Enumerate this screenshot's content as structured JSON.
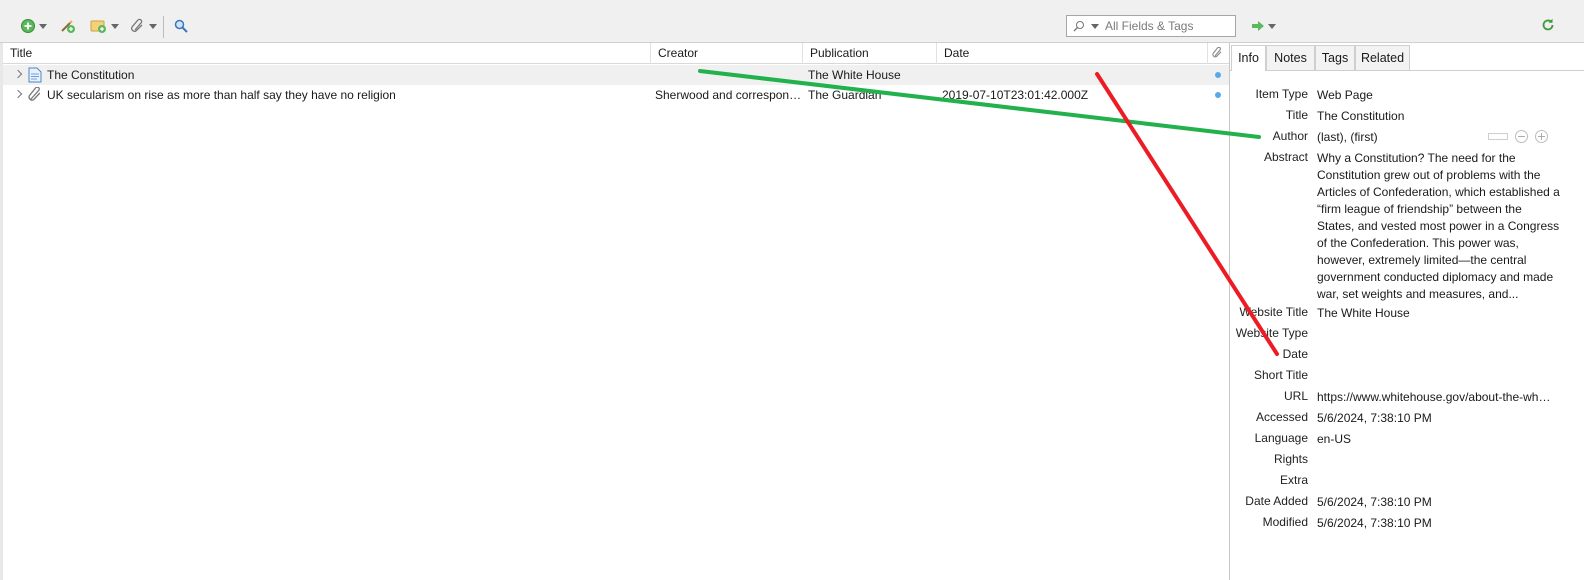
{
  "toolbar": {
    "search_placeholder": "All Fields & Tags",
    "icons": [
      "new-item-icon",
      "new-note-icon",
      "add-attachment-folder-icon",
      "attachment-icon",
      "advanced-search-icon",
      "locate-icon",
      "sync-icon"
    ]
  },
  "items_table": {
    "columns": [
      "Title",
      "Creator",
      "Publication",
      "Date"
    ],
    "rows": [
      {
        "title": "The Constitution",
        "creator": "",
        "publication": "The White House",
        "date": "",
        "type": "web-page"
      },
      {
        "title": "UK secularism on rise as more than half say they have no religion",
        "creator": "Sherwood and correspon…",
        "publication": "The Guardian",
        "date": "2019-07-10T23:01:42.000Z",
        "type": "newspaper-article"
      }
    ]
  },
  "item_pane": {
    "tabs": [
      "Info",
      "Notes",
      "Tags",
      "Related"
    ],
    "active_tab": "Info",
    "fields": [
      {
        "label": "Item Type",
        "value": "Web Page"
      },
      {
        "label": "Title",
        "value": "The Constitution"
      },
      {
        "label": "Author",
        "value": "(last), (first)"
      },
      {
        "label": "Abstract",
        "value": "Why a Constitution? The need for the Constitution grew out of problems with the Articles of Confederation, which established a “firm league of friendship” between the States, and vested most power in a Congress of the Confederation. This power was, however, extremely limited—the central government conducted diplomacy and made war, set weights and measures, and..."
      },
      {
        "label": "Website Title",
        "value": "The White House"
      },
      {
        "label": "Website Type",
        "value": ""
      },
      {
        "label": "Date",
        "value": ""
      },
      {
        "label": "Short Title",
        "value": ""
      },
      {
        "label": "URL",
        "value": "https://www.whitehouse.gov/about-the-wh…"
      },
      {
        "label": "Accessed",
        "value": "5/6/2024, 7:38:10 PM"
      },
      {
        "label": "Language",
        "value": "en-US"
      },
      {
        "label": "Rights",
        "value": ""
      },
      {
        "label": "Extra",
        "value": ""
      },
      {
        "label": "Date Added",
        "value": "5/6/2024, 7:38:10 PM"
      },
      {
        "label": "Modified",
        "value": "5/6/2024, 7:38:10 PM"
      }
    ]
  },
  "annotation_colors": {
    "green": "#22b14c",
    "red": "#ed1c24"
  }
}
